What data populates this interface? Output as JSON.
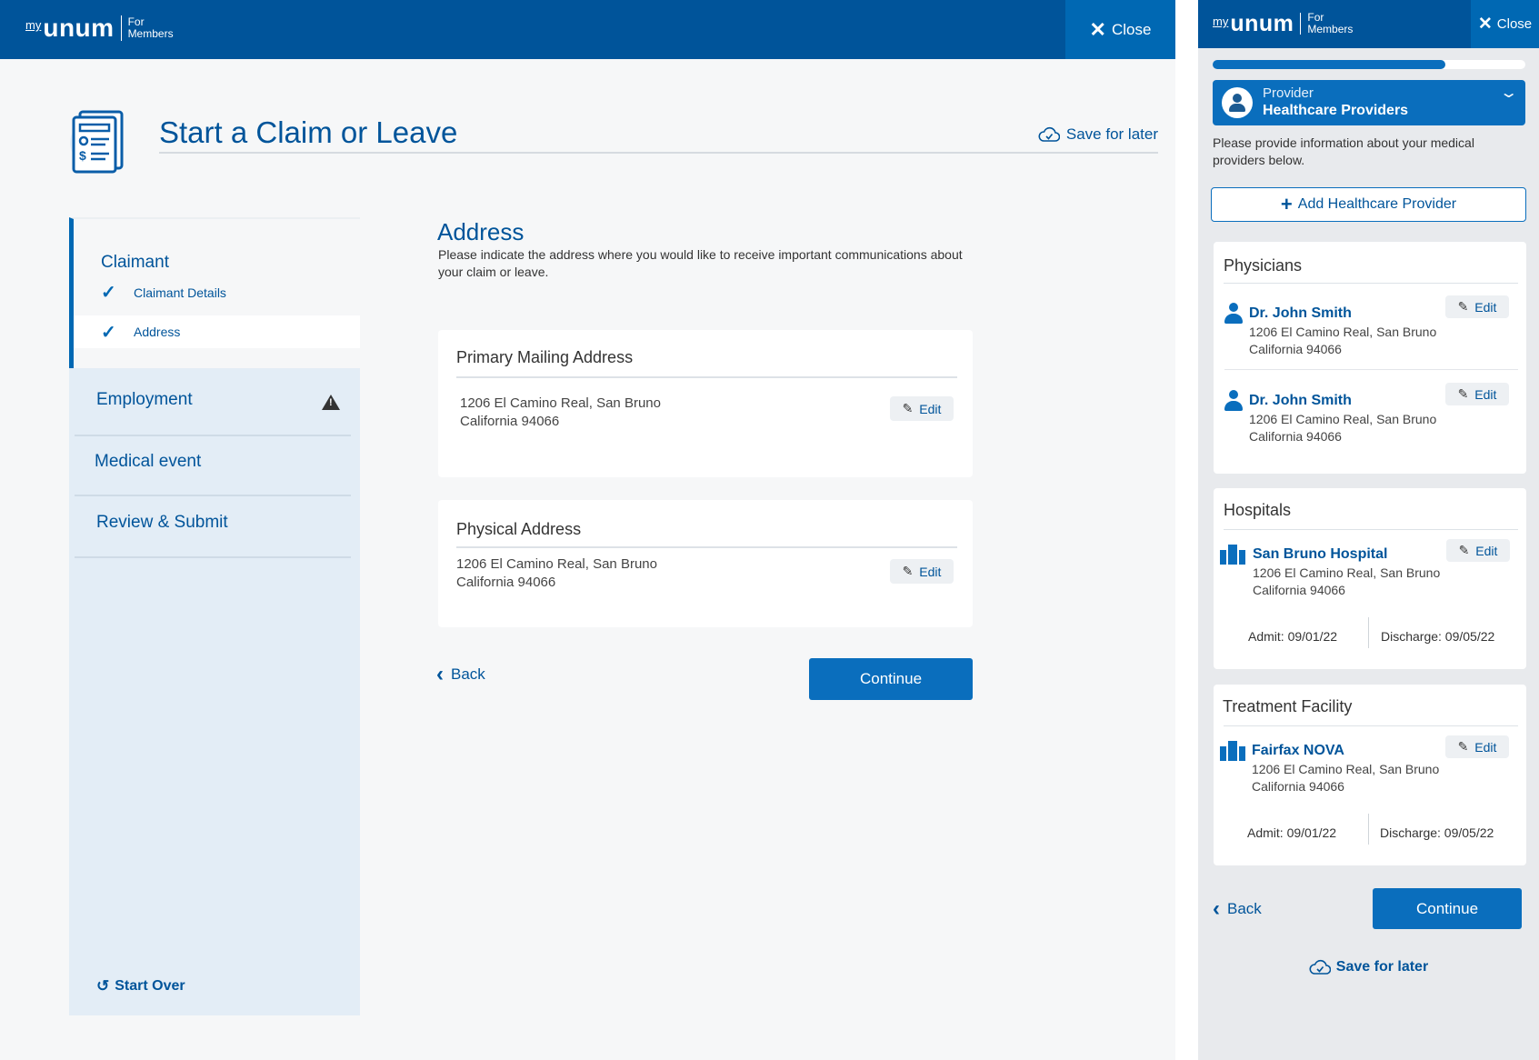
{
  "desktop": {
    "logo": {
      "my": "my",
      "brand": "unum",
      "for_line1": "For",
      "for_line2": "Members"
    },
    "close_label": "Close",
    "page_title": "Start a Claim or Leave",
    "save_for_later": "Save for later",
    "sidebar": {
      "claimant_heading": "Claimant",
      "claimant_steps": [
        {
          "label": "Claimant Details",
          "completed": true,
          "active": false
        },
        {
          "label": "Address",
          "completed": true,
          "active": true
        }
      ],
      "items": [
        {
          "label": "Employment",
          "warning": true
        },
        {
          "label": "Medical event",
          "warning": false
        },
        {
          "label": "Review & Submit",
          "warning": false
        }
      ],
      "start_over": "Start Over"
    },
    "main": {
      "heading": "Address",
      "description": "Please indicate the address where you would like to receive important communications about your claim or leave.",
      "cards": [
        {
          "title": "Primary Mailing Address",
          "line1": "1206 El Camino Real, San Bruno",
          "line2": "California 94066",
          "edit_label": "Edit"
        },
        {
          "title": "Physical Address",
          "line1": "1206 El Camino Real, San Bruno",
          "line2": "California 94066",
          "edit_label": "Edit"
        }
      ],
      "back_label": "Back",
      "continue_label": "Continue"
    }
  },
  "mobile": {
    "logo": {
      "my": "my",
      "brand": "unum",
      "for_line1": "For",
      "for_line2": "Members"
    },
    "close_label": "Close",
    "progress_fraction": 0.745,
    "step": {
      "label": "Provider",
      "value": "Healthcare Providers"
    },
    "description": "Please provide information about your medical providers below.",
    "add_provider_label": "Add Healthcare Provider",
    "physicians": {
      "title": "Physicians",
      "items": [
        {
          "name": "Dr. John Smith",
          "line1": "1206 El Camino Real, San Bruno",
          "line2": "California 94066",
          "edit_label": "Edit"
        },
        {
          "name": "Dr. John Smith",
          "line1": "1206 El Camino Real, San Bruno",
          "line2": "California 94066",
          "edit_label": "Edit"
        }
      ]
    },
    "hospitals": {
      "title": "Hospitals",
      "items": [
        {
          "name": "San Bruno Hospital",
          "line1": "1206 El Camino Real, San Bruno",
          "line2": "California 94066",
          "edit_label": "Edit",
          "admit": "Admit: 09/01/22",
          "discharge": "Discharge: 09/05/22"
        }
      ]
    },
    "treatment": {
      "title": "Treatment Facility",
      "items": [
        {
          "name": "Fairfax NOVA",
          "line1": "1206 El Camino Real, San Bruno",
          "line2": "California 94066",
          "edit_label": "Edit",
          "admit": "Admit: 09/01/22",
          "discharge": "Discharge: 09/05/22"
        }
      ]
    },
    "back_label": "Back",
    "continue_label": "Continue",
    "save_for_later": "Save for later"
  }
}
